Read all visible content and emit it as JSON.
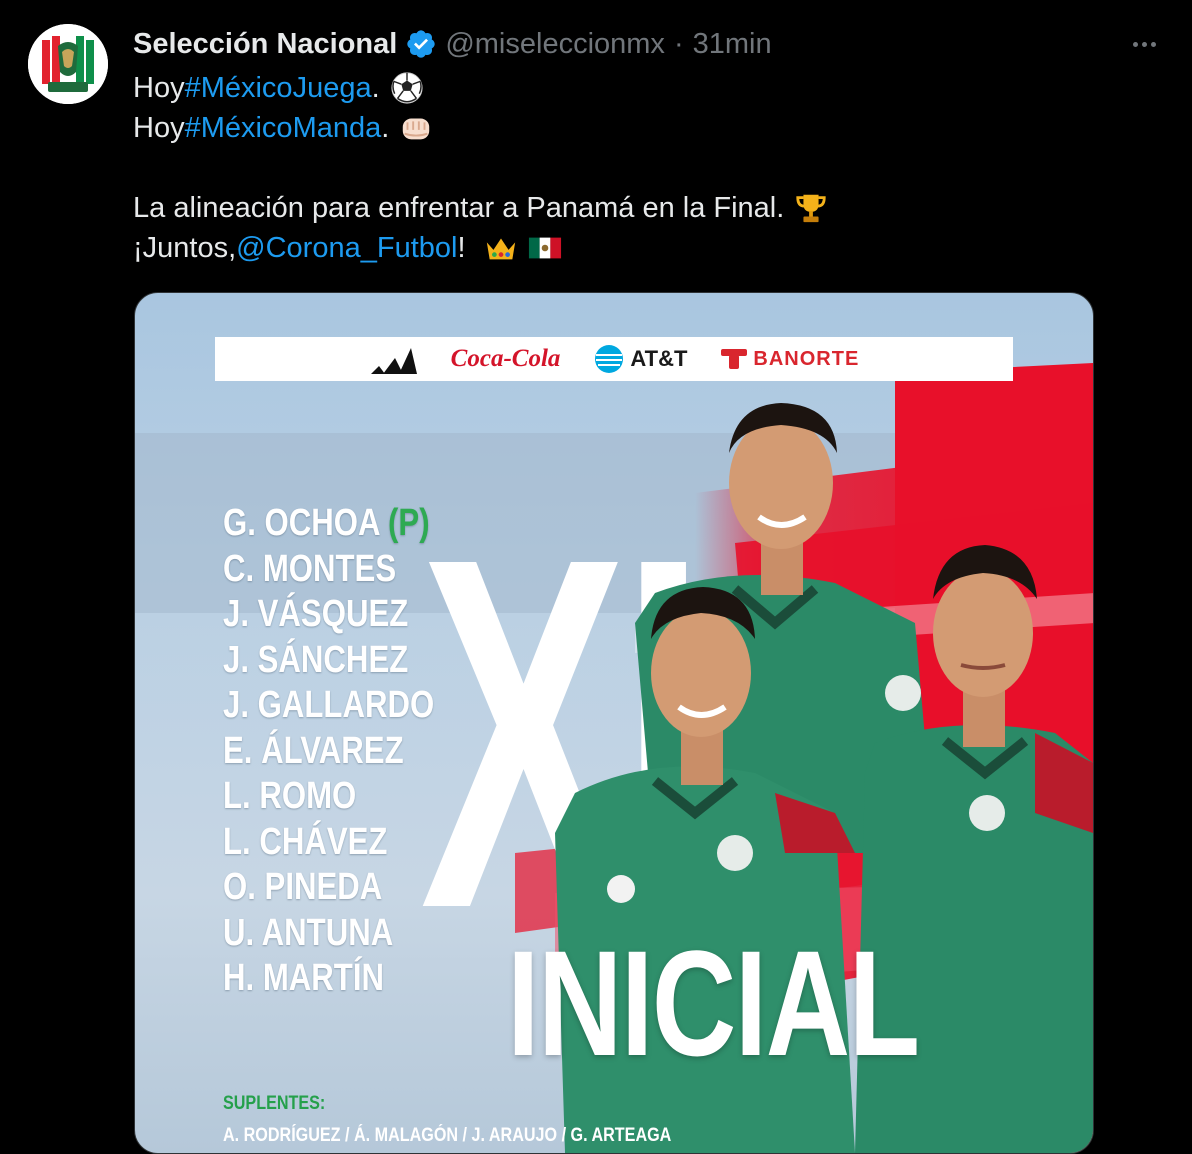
{
  "tweet": {
    "author_name": "Selección Nacional",
    "handle": "@miseleccionmx",
    "separator": "·",
    "time": "31min",
    "lines": [
      {
        "pre": "Hoy ",
        "hashtag": "#MéxicoJuega",
        "post": ".",
        "emoji": "soccer-ball-icon"
      },
      {
        "pre": "Hoy ",
        "hashtag": "#MéxicoManda",
        "post": ".",
        "emoji": "fist-icon"
      },
      {
        "pre": "La alineación para enfrentar a Panamá en la Final.",
        "emoji": "trophy-icon"
      },
      {
        "pre": "¡Juntos, ",
        "mention": "@Corona_Futbol",
        "post": "!",
        "emojis": [
          "crown-icon",
          "mexico-flag-icon"
        ]
      }
    ]
  },
  "media": {
    "sponsors": [
      {
        "name": "adidas",
        "label": "",
        "icon": "adidas-logo-icon"
      },
      {
        "name": "coca-cola",
        "label": "Coca-Cola"
      },
      {
        "name": "att",
        "label": "AT&T",
        "icon": "att-globe-icon"
      },
      {
        "name": "banorte",
        "label": "BANORTE",
        "icon": "banorte-logo-icon"
      }
    ],
    "lineup": [
      "G. OCHOA",
      "C. MONTES",
      "J. VÁSQUEZ",
      "J. SÁNCHEZ",
      "J. GALLARDO",
      "E. ÁLVAREZ",
      "L. ROMO",
      "L. CHÁVEZ",
      "O. PINEDA",
      "U. ANTUNA",
      "H. MARTÍN"
    ],
    "captain_marker": "(P)",
    "big_text": "XI",
    "inicial_text": "INICIAL",
    "suplentes_label": "SUPLENTES:",
    "suplentes_names": "A. RODRÍGUEZ / Á. MALAGÓN / J. ARAUJO / G. ARTEAGA"
  },
  "colors": {
    "background": "#000000",
    "text": "#e7e9ea",
    "muted": "#71767b",
    "link": "#1d9bf0",
    "verified": "#1d9bf0",
    "red": "#e8102a",
    "jersey_green": "#2b8a67"
  }
}
